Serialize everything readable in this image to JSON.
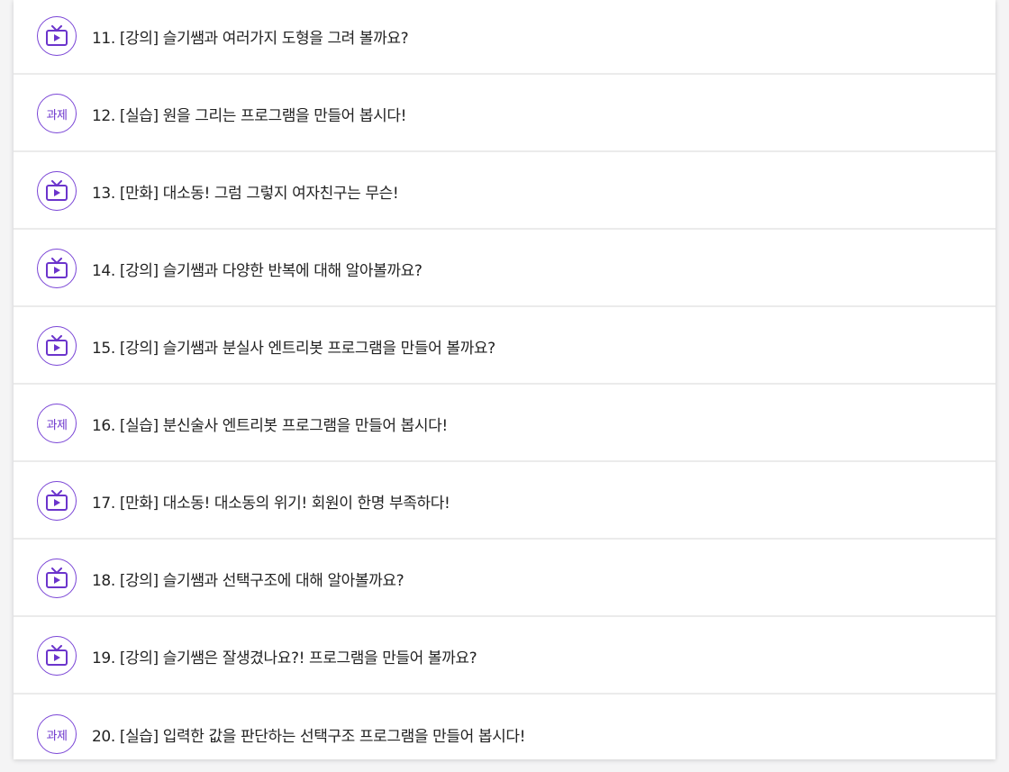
{
  "lessons": [
    {
      "type": "video",
      "title": "11. [강의] 슬기쌤과 여러가지 도형을 그려 볼까요?"
    },
    {
      "type": "task",
      "badge": "과제",
      "title": "12. [실습] 원을 그리는 프로그램을 만들어 봅시다!"
    },
    {
      "type": "video",
      "title": "13. [만화] 대소동! 그럼 그렇지 여자친구는 무슨!"
    },
    {
      "type": "video",
      "title": "14. [강의] 슬기쌤과 다양한 반복에 대해 알아볼까요?"
    },
    {
      "type": "video",
      "title": "15. [강의] 슬기쌤과 분실사 엔트리봇 프로그램을 만들어 볼까요?"
    },
    {
      "type": "task",
      "badge": "과제",
      "title": "16. [실습] 분신술사 엔트리봇 프로그램을 만들어 봅시다!"
    },
    {
      "type": "video",
      "title": "17. [만화] 대소동! 대소동의 위기! 회원이 한명 부족하다!"
    },
    {
      "type": "video",
      "title": "18. [강의] 슬기쌤과 선택구조에 대해 알아볼까요?"
    },
    {
      "type": "video",
      "title": "19. [강의] 슬기쌤은 잘생겼나요?! 프로그램을 만들어 볼까요?"
    },
    {
      "type": "task",
      "badge": "과제",
      "title": "20. [실습] 입력한 값을 판단하는 선택구조 프로그램을 만들어 봅시다!"
    }
  ],
  "icons": {
    "video": "tv-play-icon",
    "task": "task-badge-icon"
  },
  "colors": {
    "accent": "#7a45d6",
    "title_text": "#222222",
    "divider": "#ebebeb"
  }
}
